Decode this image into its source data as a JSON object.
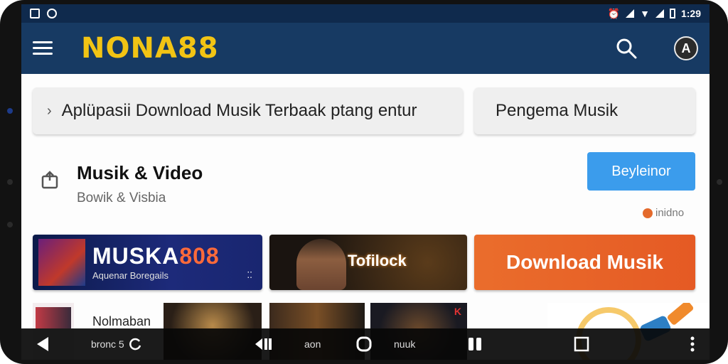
{
  "status_bar": {
    "time": "1:29"
  },
  "app_bar": {
    "logo": "NONA88",
    "avatar_letter": "A"
  },
  "search_chips": [
    {
      "label": "Aplüpasii Download Musik Terbaak ptang entur"
    },
    {
      "label": "Pengema Musik"
    }
  ],
  "section": {
    "title": "Musik & Video",
    "subtitle": "Bowik & Visbia",
    "button_label": "Beyleinor",
    "meta": "inidno"
  },
  "banners": [
    {
      "title_main": "MUSKA",
      "title_accent": "808",
      "subtitle": "Aquenar Boregails"
    },
    {
      "title": "Tofilock"
    },
    {
      "title": "Download Musik"
    }
  ],
  "thumbnails": {
    "label": "Nolmaban",
    "thumb4_badge": "K"
  },
  "nav_bar": {
    "labels": [
      "bronc 5",
      "aon",
      "nuuk"
    ]
  },
  "colors": {
    "app_bar": "#173a63",
    "logo": "#f2c414",
    "primary_button": "#3b9cec",
    "banner_orange": "#ea6d2c"
  }
}
